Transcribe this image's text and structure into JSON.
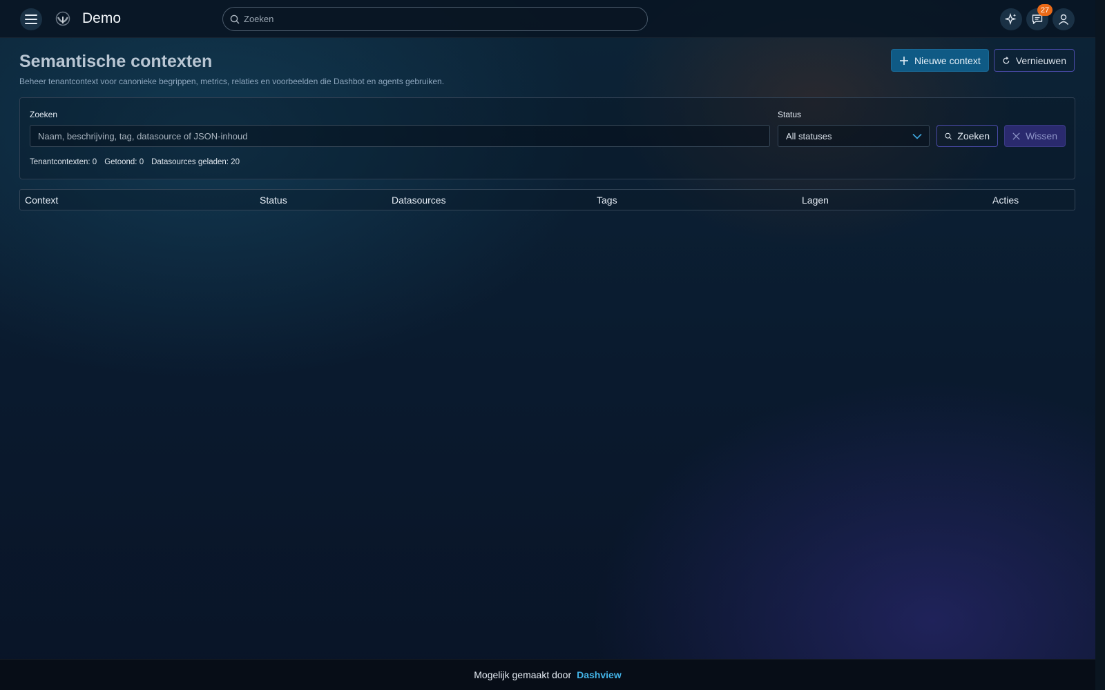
{
  "header": {
    "brand": "Demo",
    "search_placeholder": "Zoeken",
    "notification_count": "27",
    "icons": [
      "menu-icon",
      "logo-icon",
      "sparkle-icon",
      "chat-icon",
      "user-icon"
    ]
  },
  "page": {
    "title": "Semantische contexten",
    "subtitle": "Beheer tenantcontext voor canonieke begrippen, metrics, relaties en voorbeelden die Dashbot en agents gebruiken.",
    "new_button": "Nieuwe context",
    "refresh_button": "Vernieuwen"
  },
  "filters": {
    "search_label": "Zoeken",
    "search_placeholder": "Naam, beschrijving, tag, datasource of JSON-inhoud",
    "search_value": "",
    "status_label": "Status",
    "status_selected": "All statuses",
    "search_button": "Zoeken",
    "clear_button": "Wissen"
  },
  "stats": {
    "tenant": "Tenantcontexten: 0",
    "shown": "Getoond: 0",
    "datasources": "Datasources geladen: 20"
  },
  "table": {
    "columns": [
      "Context",
      "Status",
      "Datasources",
      "Tags",
      "Lagen",
      "Acties"
    ],
    "rows": []
  },
  "footer": {
    "text": "Mogelijk gemaakt door",
    "link": "Dashview"
  },
  "colors": {
    "primary": "#0f5a85",
    "accent_border": "#4a4aa8",
    "badge": "#ea6a18",
    "link": "#43b4e8"
  }
}
